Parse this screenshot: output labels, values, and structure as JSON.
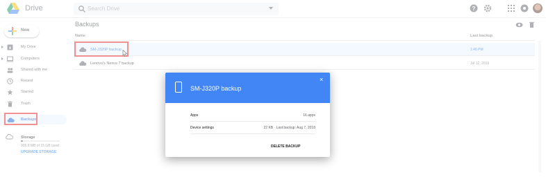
{
  "app": {
    "title": "Drive"
  },
  "search": {
    "placeholder": "Search Drive"
  },
  "sidebar": {
    "new_label": "New",
    "items": [
      {
        "label": "My Drive",
        "icon": "drive-icon"
      },
      {
        "label": "Computers",
        "icon": "computer-icon"
      },
      {
        "label": "Shared with me",
        "icon": "people-icon"
      },
      {
        "label": "Recent",
        "icon": "clock-icon"
      },
      {
        "label": "Starred",
        "icon": "star-icon"
      },
      {
        "label": "Trash",
        "icon": "trash-icon"
      },
      {
        "label": "Backups",
        "icon": "cloud-icon",
        "active": true
      }
    ],
    "storage": {
      "label": "Storage",
      "used": "905.8 MB of 15 GB used",
      "upgrade": "UPGRADE STORAGE",
      "fraction_used": 0.06
    }
  },
  "main": {
    "title": "Backups",
    "columns": {
      "name": "Name",
      "last_backup": "Last backup"
    },
    "rows": [
      {
        "name": "SM-J320P backup",
        "last_backup": "1:46 PM",
        "selected": true
      },
      {
        "name": "Lenovo's Nexus 7 backup",
        "last_backup": "Jul 12, 2016",
        "selected": false
      }
    ]
  },
  "dialog": {
    "title": "SM-J320P backup",
    "close": "×",
    "rows": [
      {
        "key": "Apps",
        "value": "16 apps"
      },
      {
        "key": "Device settings",
        "value": "22 KB · Last backup: Aug 7, 2018"
      }
    ],
    "action": "DELETE BACKUP"
  },
  "colors": {
    "accent": "#4285f4",
    "selection": "#e8f0fe",
    "highlight_box": "#e02020"
  }
}
